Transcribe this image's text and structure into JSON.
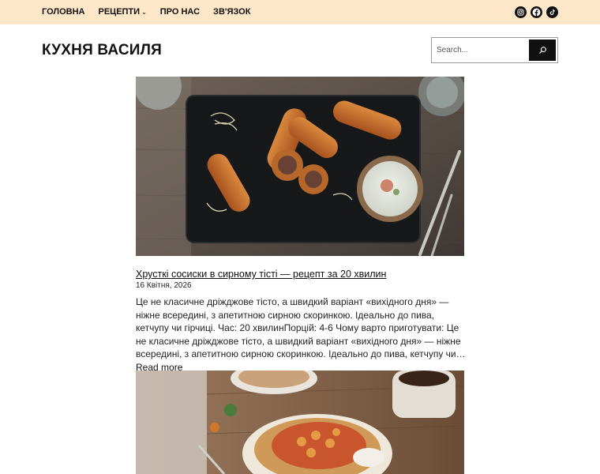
{
  "nav": {
    "items": [
      {
        "label": "ГОЛОВНА"
      },
      {
        "label": "РЕЦЕПТИ",
        "has_dropdown": true
      },
      {
        "label": "ПРО НАС"
      },
      {
        "label": "ЗВ'ЯЗОК"
      }
    ],
    "dropdown_glyph": "⌄"
  },
  "socials": [
    {
      "icon": "instagram-icon"
    },
    {
      "icon": "facebook-icon"
    },
    {
      "icon": "tiktok-icon"
    }
  ],
  "site": {
    "title": "КУХНЯ ВАСИЛЯ"
  },
  "search": {
    "placeholder": "Search..."
  },
  "posts": [
    {
      "title": "Хрусткі сосиски в сирному тісті — рецепт за 20 хвилин",
      "date": "16 Квітня, 2026",
      "excerpt": "Це не класичне дріжджове тісто, а швидкий варіант «вихідного дня» — ніжне всередині, з апетитною сирною скоринкою. Ідеально до пива, кетчупу чи гірчиці. Час: 20 хвилинПорцій: 4-6 Чому варто приготувати: Це не класичне дріжджове тісто, а швидкий варіант «вихідного дня» — ніжне всередині, з апетитною сирною скоринкою. Ідеально до пива, кетчупу чи…",
      "read_more": "Read more"
    }
  ],
  "colors": {
    "topbar": "#fde7c8",
    "text": "#111111",
    "button": "#111111"
  }
}
